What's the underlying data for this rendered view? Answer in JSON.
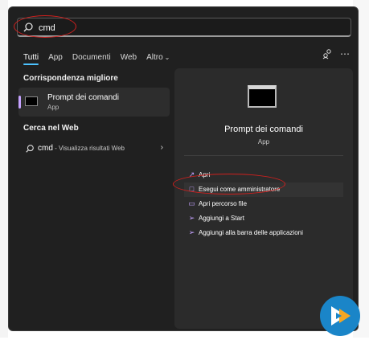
{
  "search": {
    "value": "cmd",
    "placeholder": ""
  },
  "tabs": [
    {
      "label": "Tutti",
      "active": true
    },
    {
      "label": "App",
      "active": false
    },
    {
      "label": "Documenti",
      "active": false
    },
    {
      "label": "Web",
      "active": false
    },
    {
      "label": "Altro",
      "active": false
    }
  ],
  "header_icons": [
    "share-accounts-icon",
    "more-icon"
  ],
  "best_match": {
    "section": "Corrispondenza migliore",
    "name": "Prompt dei comandi",
    "type": "App"
  },
  "web": {
    "section": "Cerca nel Web",
    "query": "cmd",
    "suffix": " - Visualizza risultati Web"
  },
  "detail": {
    "title": "Prompt dei comandi",
    "type": "App",
    "actions": [
      {
        "label": "Apri",
        "icon": "open-icon"
      },
      {
        "label": "Esegui come amministratore",
        "icon": "admin-shield-icon"
      },
      {
        "label": "Apri percorso file",
        "icon": "folder-icon"
      },
      {
        "label": "Aggiungi a Start",
        "icon": "pin-icon"
      },
      {
        "label": "Aggiungi alla barra delle applicazioni",
        "icon": "pin-icon"
      }
    ]
  },
  "colors": {
    "panel": "#202020",
    "accent": "#4cc2ff",
    "highlight": "#d0201e",
    "icon_purple": "#c5a2ff"
  }
}
